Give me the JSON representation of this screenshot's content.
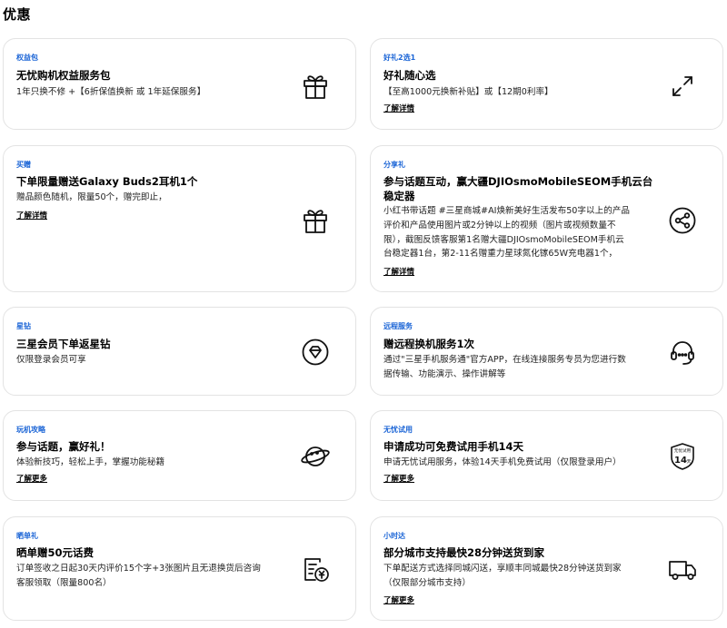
{
  "page": {
    "title": "优惠"
  },
  "cards": [
    {
      "tag": "权益包",
      "title": "无忧购机权益服务包",
      "desc": "1年只换不修 +【6折保值换新 或 1年延保服务】",
      "icon": "gift-icon"
    },
    {
      "tag": "好礼2选1",
      "title": "好礼随心选",
      "desc": "【至高1000元换新补贴】或【12期0利率】",
      "link": "了解详情",
      "icon": "expand-arrows-icon"
    },
    {
      "tag": "买赠",
      "title": "下单限量赠送Galaxy Buds2耳机1个",
      "desc": "赠品颜色随机，限量50个，赠完即止，",
      "link": "了解详情",
      "icon": "gift-icon"
    },
    {
      "tag": "分享礼",
      "title_lines": [
        "参与话题互动，赢大疆DJIOsmoMobileSEOM手机云台",
        "稳定器"
      ],
      "desc_lines": [
        "小红书带话题 #三星商城#AI焕新美好生活发布50字以上的产品",
        "评价和产品使用图片或2分钟以上的视频（图片或视频数量不",
        "限），截图反馈客服第1名赠大疆DJIOsmoMobileSEOM手机云",
        "台稳定器1台，第2-11名赠重力星球氮化镓65W充电器1个，"
      ],
      "link": "了解详情",
      "icon": "share-icon"
    },
    {
      "tag": "星钻",
      "title": "三星会员下单返星钻",
      "desc": "仅限登录会员可享",
      "icon": "diamond-icon"
    },
    {
      "tag": "远程服务",
      "title": "赠远程换机服务1次",
      "desc_lines": [
        "通过\"三星手机服务通\"官方APP，在线连接服务专员为您进行数",
        "据传输、功能演示、操作讲解等"
      ],
      "icon": "headset-icon"
    },
    {
      "tag": "玩机攻略",
      "title": "参与话题，赢好礼！",
      "desc": "体验新技巧，轻松上手，掌握功能秘籍",
      "link": "了解更多",
      "icon": "planet-icon"
    },
    {
      "tag": "无忧试用",
      "title": "申请成功可免费试用手机14天",
      "desc": "申请无忧试用服务，体验14天手机免费试用（仅限登录用户）",
      "link": "了解更多",
      "icon": "trial-badge-icon",
      "badge_top": "无忧试用",
      "badge_num": "14",
      "badge_unit": "天"
    },
    {
      "tag": "晒单礼",
      "title": "晒单赠50元话费",
      "desc_lines": [
        "订单签收之日起30天内评价15个字+3张图片且无退换货后咨询",
        "客服领取（限量800名）"
      ],
      "icon": "review-coupon-icon"
    },
    {
      "tag": "小时达",
      "title": "部分城市支持最快28分钟送货到家",
      "desc_lines": [
        "下单配送方式选择同城闪送，享顺丰同城最快28分钟送货到家",
        "（仅限部分城市支持）"
      ],
      "link": "了解更多",
      "icon": "delivery-truck-icon"
    }
  ]
}
